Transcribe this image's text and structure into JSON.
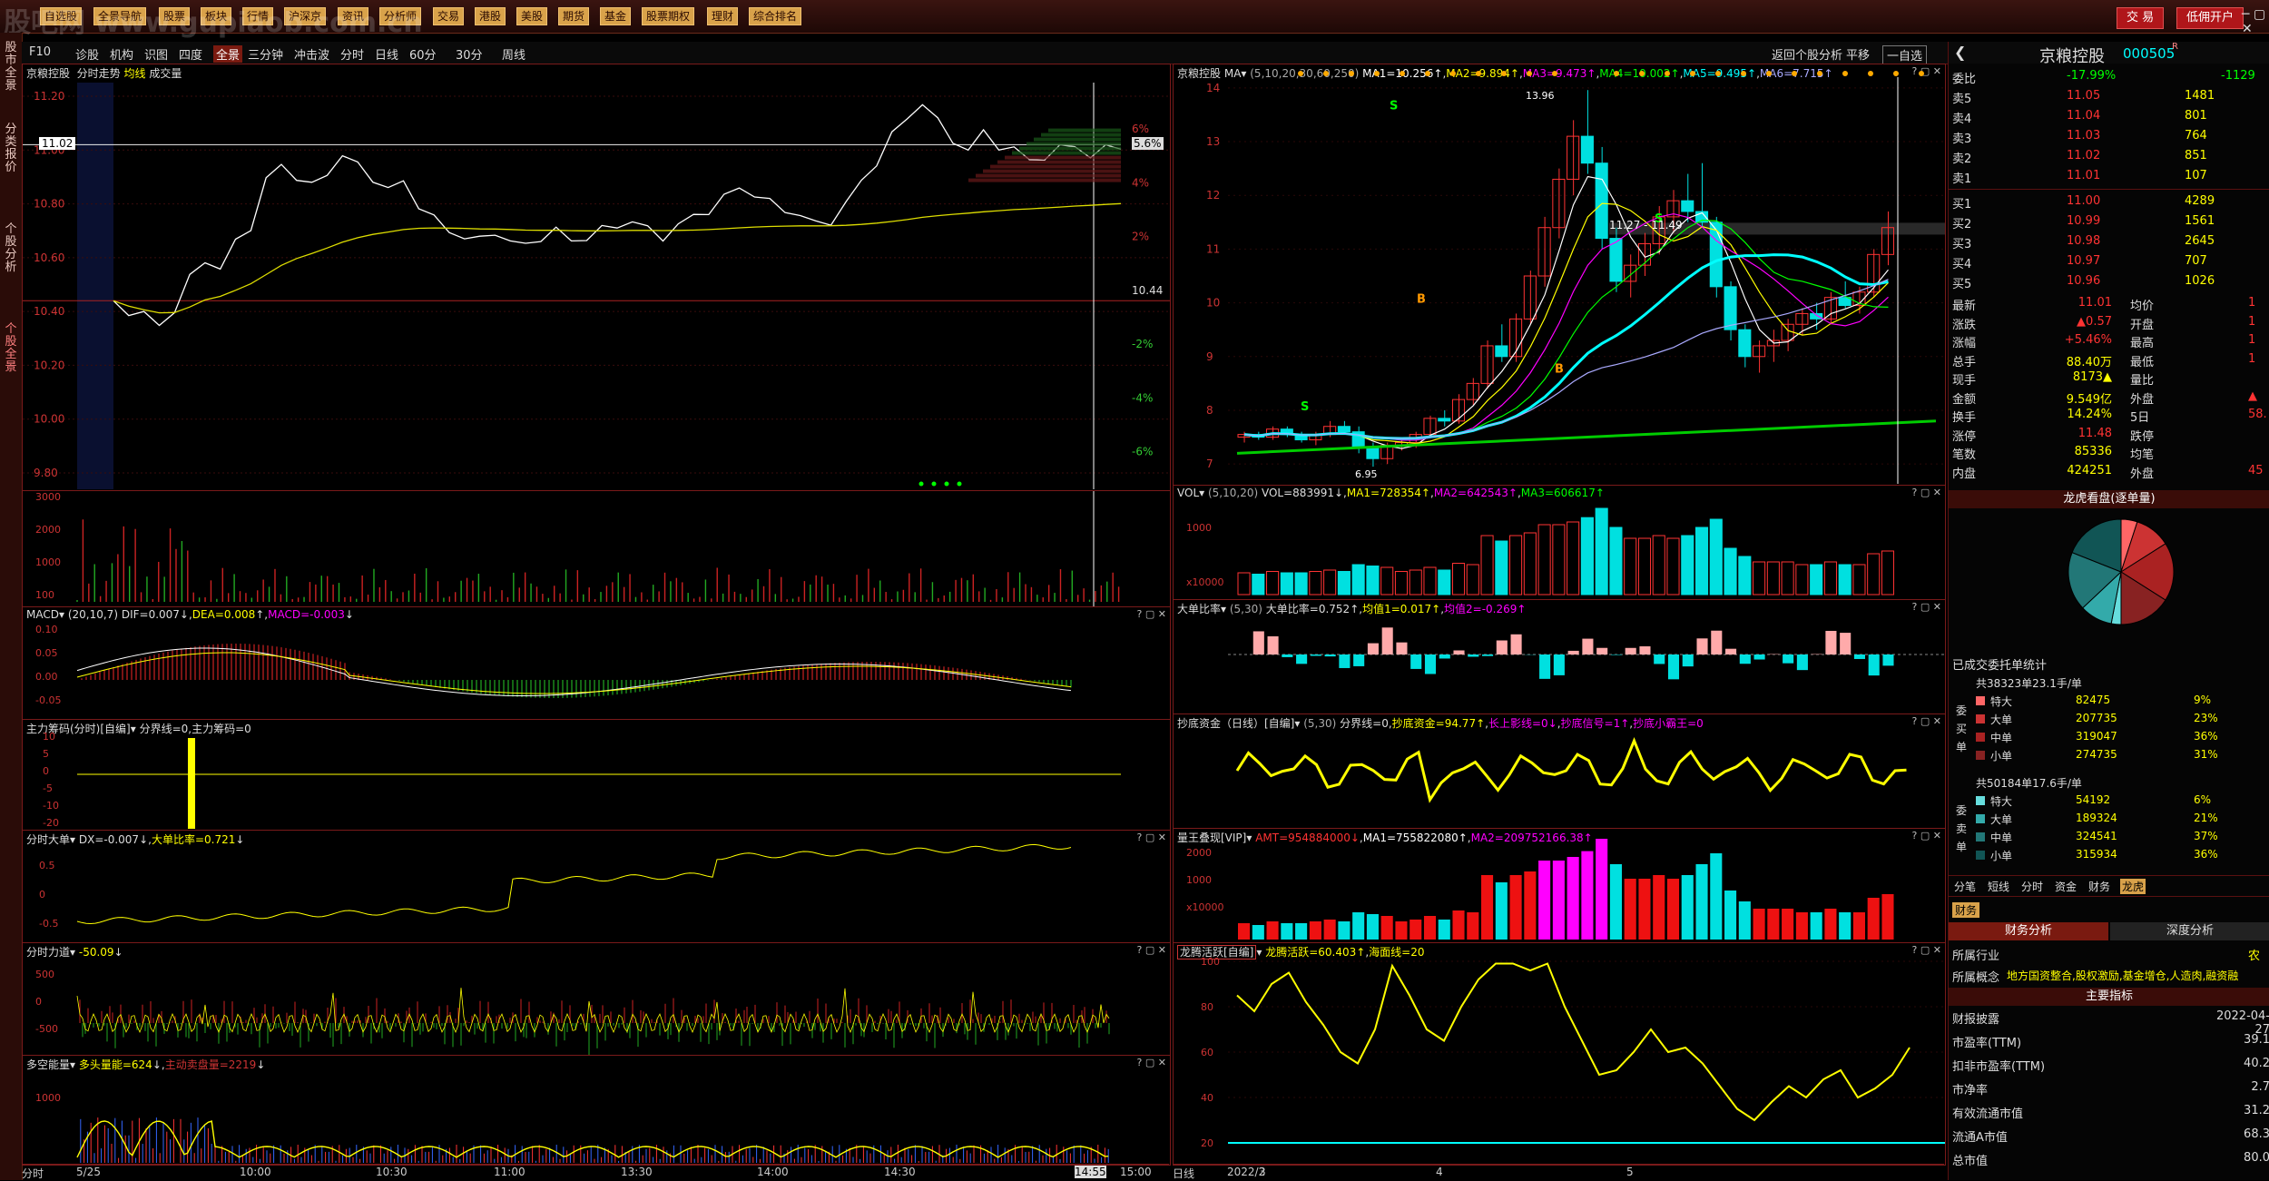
{
  "watermark": "股吧网 www.gupiaob.com.cn",
  "topmenu": [
    "自选股",
    "全景导航",
    "股票",
    "板块",
    "行情",
    "沪深京",
    "资讯",
    "分析师",
    "交易",
    "港股",
    "美股",
    "期货",
    "基金",
    "股票期权",
    "理财",
    "综合排名"
  ],
  "topbuttons": {
    "trade": "交 易",
    "open_account": "低佣开户"
  },
  "leftstrip": [
    "股市全景",
    "分类报价",
    "个股分析",
    "个股全景"
  ],
  "row2": [
    "F10",
    "诊股",
    "机构",
    "识图",
    "四度",
    "全景",
    "三分钟",
    "冲击波",
    "分时",
    "日线",
    "60分",
    "30分",
    "周线"
  ],
  "row2_right": {
    "back": "返回个股分析",
    "flat": "平移",
    "self": "一自选"
  },
  "colors": {
    "up": "#ff3333",
    "down": "#00e0e0",
    "yellow": "#ffff00",
    "white": "#ffffff",
    "bg": "#000000",
    "grid": "#7a1a1a"
  },
  "intraday": {
    "title": "京粮控股",
    "sub": "分时走势",
    "avg": "均线",
    "vol": "成交量",
    "y_labels": [
      "11.20",
      "11.00",
      "10.80",
      "10.60",
      "10.40",
      "10.20",
      "10.00",
      "9.80"
    ],
    "pct_labels": [
      "6%",
      "4%",
      "2%",
      "10.44",
      "-2%",
      "-4%",
      "-6%"
    ],
    "current_price": "11.02",
    "current_pct": "5.6%",
    "time_labels": [
      "分时",
      "5/25",
      "10:00",
      "10:30",
      "11:00",
      "13:30",
      "14:00",
      "14:30",
      "14:55",
      "15:00"
    ],
    "vol_labels": [
      "3000",
      "2000",
      "1000",
      "100"
    ],
    "price_series": [
      10.44,
      10.4,
      10.38,
      10.36,
      10.4,
      10.52,
      10.6,
      10.55,
      10.66,
      10.72,
      10.88,
      10.95,
      10.9,
      10.86,
      10.92,
      10.98,
      10.94,
      10.9,
      10.85,
      10.88,
      10.8,
      10.74,
      10.7,
      10.68,
      10.66,
      10.7,
      10.66,
      10.64,
      10.68,
      10.7,
      10.66,
      10.68,
      10.7,
      10.72,
      10.74,
      10.7,
      10.68,
      10.72,
      10.75,
      10.78,
      10.82,
      10.86,
      10.84,
      10.8,
      10.78,
      10.76,
      10.72,
      10.74,
      10.8,
      10.88,
      10.96,
      11.05,
      11.12,
      11.18,
      11.1,
      11.04,
      11.0,
      11.06,
      11.02,
      11.0,
      10.96,
      10.98,
      11.0,
      11.02,
      10.98,
      11.0,
      11.02
    ]
  },
  "macd": {
    "title": "MACD",
    "params": "(20,10,7)",
    "dif": "DIF=0.007",
    "dea": "DEA=0.008",
    "macd": "MACD=-0.003",
    "y": [
      "0.10",
      "0.05",
      "0.00",
      "-0.05"
    ]
  },
  "zhuli": {
    "title": "主力筹码(分时)[自编]",
    "line": "分界线=0,主力筹码=0",
    "y": [
      "10",
      "5",
      "0",
      "-5",
      "-10",
      "-20"
    ]
  },
  "fenshi_big": {
    "title": "分时大单",
    "dx": "DX=-0.007",
    "ratio": "大单比率=0.721",
    "y": [
      "0.5",
      "0",
      "-0.5"
    ]
  },
  "fenshi_force": {
    "title": "分时力道",
    "val": "-50.09",
    "y": [
      "500",
      "0",
      "-500"
    ]
  },
  "duokong": {
    "title": "多空能量",
    "a": "多头量能=624",
    "b": "主动卖盘量=2219",
    "y": [
      "1000"
    ]
  },
  "daily": {
    "title": "京粮控股",
    "ma": "MA",
    "params": "(5,10,20,30,60,250)",
    "ma_vals": [
      "MA1=10.256↑",
      "MA2=9.894↑",
      "MA3=9.473↑",
      "MA4=10.002↑",
      "MA5=9.495↑",
      "MA6=7.715↑"
    ],
    "y": [
      "14",
      "13",
      "12",
      "11",
      "10",
      "9",
      "8",
      "7"
    ],
    "hi": "13.96",
    "lo": "6.95",
    "band": "11.27 - 11.49",
    "x_labels": [
      "日线",
      "2022/2",
      "3",
      "4",
      "5"
    ],
    "candles": [
      [
        7.5,
        7.6,
        7.4,
        7.55
      ],
      [
        7.55,
        7.6,
        7.45,
        7.5
      ],
      [
        7.5,
        7.7,
        7.45,
        7.65
      ],
      [
        7.65,
        7.7,
        7.5,
        7.55
      ],
      [
        7.55,
        7.6,
        7.4,
        7.45
      ],
      [
        7.45,
        7.6,
        7.35,
        7.55
      ],
      [
        7.55,
        7.8,
        7.5,
        7.7
      ],
      [
        7.7,
        7.8,
        7.55,
        7.6
      ],
      [
        7.6,
        7.7,
        7.2,
        7.3
      ],
      [
        7.3,
        7.4,
        6.95,
        7.1
      ],
      [
        7.1,
        7.4,
        7.0,
        7.35
      ],
      [
        7.35,
        7.5,
        7.25,
        7.4
      ],
      [
        7.4,
        7.6,
        7.3,
        7.55
      ],
      [
        7.55,
        7.9,
        7.5,
        7.85
      ],
      [
        7.85,
        8.0,
        7.7,
        7.8
      ],
      [
        7.8,
        8.3,
        7.75,
        8.2
      ],
      [
        8.2,
        8.6,
        8.1,
        8.5
      ],
      [
        8.5,
        9.3,
        8.4,
        9.2
      ],
      [
        9.2,
        9.6,
        8.9,
        9.0
      ],
      [
        9.0,
        9.8,
        8.9,
        9.7
      ],
      [
        9.7,
        10.6,
        9.6,
        10.5
      ],
      [
        10.5,
        11.6,
        10.3,
        11.4
      ],
      [
        11.4,
        12.5,
        11.2,
        12.3
      ],
      [
        12.3,
        13.4,
        12.0,
        13.1
      ],
      [
        13.1,
        13.96,
        12.4,
        12.6
      ],
      [
        12.6,
        12.9,
        11.0,
        11.2
      ],
      [
        11.2,
        11.4,
        10.2,
        10.4
      ],
      [
        10.4,
        10.9,
        10.1,
        10.7
      ],
      [
        10.7,
        11.3,
        10.5,
        11.1
      ],
      [
        11.1,
        11.8,
        10.9,
        11.6
      ],
      [
        11.6,
        12.1,
        11.3,
        11.9
      ],
      [
        11.9,
        12.4,
        11.5,
        11.7
      ],
      [
        11.7,
        12.6,
        11.4,
        11.5
      ],
      [
        11.5,
        11.6,
        10.1,
        10.3
      ],
      [
        10.3,
        10.4,
        9.3,
        9.5
      ],
      [
        9.5,
        9.6,
        8.8,
        9.0
      ],
      [
        9.0,
        9.3,
        8.7,
        9.2
      ],
      [
        9.2,
        9.5,
        8.9,
        9.3
      ],
      [
        9.3,
        9.7,
        9.1,
        9.6
      ],
      [
        9.6,
        9.9,
        9.4,
        9.8
      ],
      [
        9.8,
        10.0,
        9.5,
        9.7
      ],
      [
        9.7,
        10.2,
        9.6,
        10.1
      ],
      [
        10.1,
        10.4,
        9.9,
        9.95
      ],
      [
        9.95,
        10.3,
        9.8,
        10.2
      ],
      [
        10.2,
        11.0,
        10.1,
        10.9
      ],
      [
        10.9,
        11.7,
        10.7,
        11.4
      ]
    ]
  },
  "vol_daily": {
    "title": "VOL",
    "params": "(5,10,20)",
    "vol": "VOL=883991↓",
    "ma": [
      "MA1=728354↑",
      "MA2=642543↑",
      "MA3=606617↑"
    ],
    "y": [
      "1000",
      "x10000"
    ]
  },
  "big_ratio": {
    "title": "大单比率",
    "params": "(5,30)",
    "vals": [
      "大单比率=0.752↑",
      "均值1=0.017↑",
      "均值2=-0.269↑"
    ]
  },
  "chaodi": {
    "title": "抄底资金（日线）[自编]",
    "params": "(5,30)",
    "vals": [
      "分界线=0",
      "抄底资金=94.77↑",
      "长上影线=0↓",
      "抄底信号=1↑",
      "抄底小霸王=0"
    ]
  },
  "lianwang": {
    "title": "量王叠现[VIP]",
    "amt": "AMT=954884000↓",
    "ma1": "MA1=755822080↑",
    "ma2": "MA2=209752166.38↑",
    "y": [
      "2000",
      "1000",
      "x10000"
    ]
  },
  "longteng": {
    "title": "龙腾活跃[自编]",
    "vals": [
      "龙腾活跃=60.403↑",
      "海面线=20"
    ],
    "y": [
      "100",
      "80",
      "60",
      "40",
      "20"
    ],
    "series": [
      85,
      78,
      90,
      95,
      82,
      72,
      60,
      55,
      70,
      98,
      85,
      70,
      65,
      80,
      92,
      99,
      99,
      96,
      99,
      80,
      65,
      50,
      52,
      60,
      70,
      60,
      62,
      55,
      45,
      35,
      30,
      38,
      45,
      40,
      48,
      52,
      40,
      44,
      50,
      62
    ]
  },
  "quote": {
    "name": "京粮控股",
    "code": "000505",
    "r": "R",
    "weibi": "委比",
    "weibi_val": "-17.99%",
    "weibi_n": "-1129",
    "sell": [
      [
        "卖5",
        "11.05",
        "1481"
      ],
      [
        "卖4",
        "11.04",
        "801"
      ],
      [
        "卖3",
        "11.03",
        "764"
      ],
      [
        "卖2",
        "11.02",
        "851"
      ],
      [
        "卖1",
        "11.01",
        "107"
      ]
    ],
    "buy": [
      [
        "买1",
        "11.00",
        "4289"
      ],
      [
        "买2",
        "10.99",
        "1561"
      ],
      [
        "买3",
        "10.98",
        "2645"
      ],
      [
        "买4",
        "10.97",
        "707"
      ],
      [
        "买5",
        "10.96",
        "1026"
      ]
    ],
    "stats": [
      [
        "最新",
        "11.01",
        "均价",
        "1"
      ],
      [
        "涨跌",
        "▲0.57",
        "开盘",
        "1"
      ],
      [
        "涨幅",
        "+5.46%",
        "最高",
        "1"
      ],
      [
        "总手",
        "88.40万",
        "最低",
        "1"
      ],
      [
        "现手",
        "8173▲",
        "量比",
        ""
      ],
      [
        "金额",
        "9.549亿",
        "外盘",
        "▲"
      ],
      [
        "换手",
        "14.24%",
        "5日",
        "58."
      ],
      [
        "涨停",
        "11.48",
        "跌停",
        ""
      ],
      [
        "笔数",
        "85336",
        "均笔",
        ""
      ],
      [
        "内盘",
        "424251",
        "外盘",
        "45"
      ]
    ],
    "pie_title": "龙虎看盘(逐单量)",
    "weituo_title": "已成交委托单统计",
    "buy_hdr": "共38323单23.1手/单",
    "buy_rows": [
      [
        "特大",
        "82475",
        "9%"
      ],
      [
        "大单",
        "207735",
        "23%"
      ],
      [
        "中单",
        "319047",
        "36%"
      ],
      [
        "小单",
        "274735",
        "31%"
      ]
    ],
    "sell_hdr": "共50184单17.6手/单",
    "sell_rows": [
      [
        "特大",
        "54192",
        "6%"
      ],
      [
        "大单",
        "189324",
        "21%"
      ],
      [
        "中单",
        "324541",
        "37%"
      ],
      [
        "小单",
        "315934",
        "36%"
      ]
    ],
    "side_buy": [
      "委",
      "买",
      "单"
    ],
    "side_sell": [
      "委",
      "卖",
      "单"
    ],
    "tabs": [
      "分笔",
      "短线",
      "分时",
      "资金",
      "财务",
      "龙虎"
    ],
    "caiwu": "财务",
    "fin": "财务分析",
    "deep": "深度分析",
    "industry_k": "所属行业",
    "industry_v": "农",
    "concept_k": "所属概念",
    "concept_v": "地方国资整合,股权激励,基金增仓,人造肉,融资融",
    "key_ind": "主要指标",
    "fin_rows": [
      [
        "财报披露",
        "2022-04-27"
      ],
      [
        "市盈率(TTM)",
        "39.1"
      ],
      [
        "扣非市盈率(TTM)",
        "40.2"
      ],
      [
        "市净率",
        "2.7"
      ],
      [
        "有效流通市值",
        "31.2"
      ],
      [
        "流通A市值",
        "68.3"
      ],
      [
        "总市值",
        "80.0"
      ]
    ]
  }
}
